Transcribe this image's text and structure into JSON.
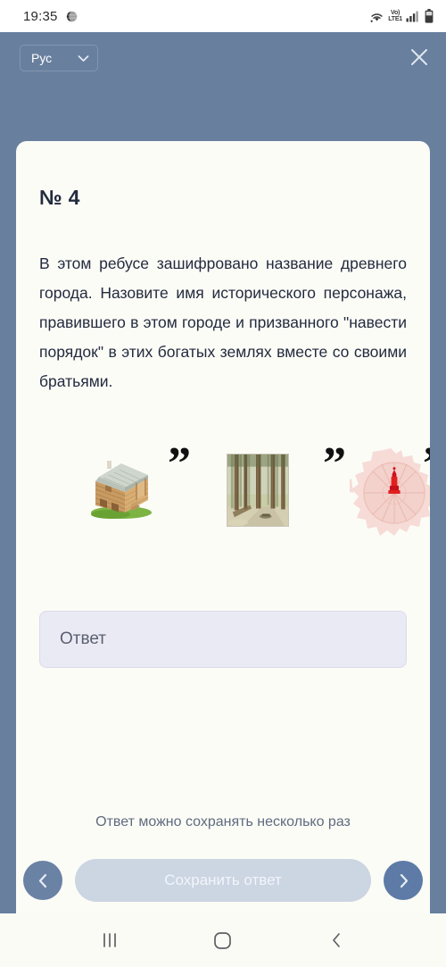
{
  "status_bar": {
    "time": "19:35",
    "icons": [
      "globe-icon",
      "wifi-icon",
      "volte-icon",
      "signal-icon",
      "battery-icon"
    ],
    "volte_top": "Vo)",
    "volte_bottom": "LTE1"
  },
  "header": {
    "language_label": "Рус",
    "language_chevron": "chevron-down-icon",
    "close_label": "close-icon",
    "background_color": "#687f9e"
  },
  "card": {
    "task_number": "№ 4",
    "question": "В этом ребусе зашифровано название древнего города. Назовите имя исторического персонажа, правившего в этом городе и призванного \"навести порядок\" в этих богатых землях вместе со своими братьями.",
    "background_color": "#fcfcf7"
  },
  "rebus": {
    "items": [
      {
        "kind": "image",
        "name": "log-house-image",
        "alt": "Деревянная изба"
      },
      {
        "kind": "apostrophes",
        "name": "apostrophe-marks-1",
        "glyph": "”"
      },
      {
        "kind": "image",
        "name": "forest-painting-image",
        "alt": "Сосновый лес"
      },
      {
        "kind": "apostrophes",
        "name": "apostrophe-marks-2",
        "glyph": "”"
      },
      {
        "kind": "image",
        "name": "moscow-map-image",
        "alt": "Карта Москвы с Кремлём"
      },
      {
        "kind": "apostrophes",
        "name": "apostrophe-marks-3",
        "glyph": "”"
      }
    ]
  },
  "answer": {
    "value": "",
    "placeholder": "Ответ",
    "background_color": "#eaeaf5"
  },
  "footer": {
    "hint": "Ответ можно сохранять несколько раз",
    "save_label": "Сохранить ответ",
    "prev_label": "chevron-left-icon",
    "next_label": "chevron-right-icon",
    "save_button_color": "#ccd5e2"
  },
  "android_nav": {
    "recents_label": "recents-icon",
    "home_label": "home-icon",
    "back_label": "back-icon"
  }
}
